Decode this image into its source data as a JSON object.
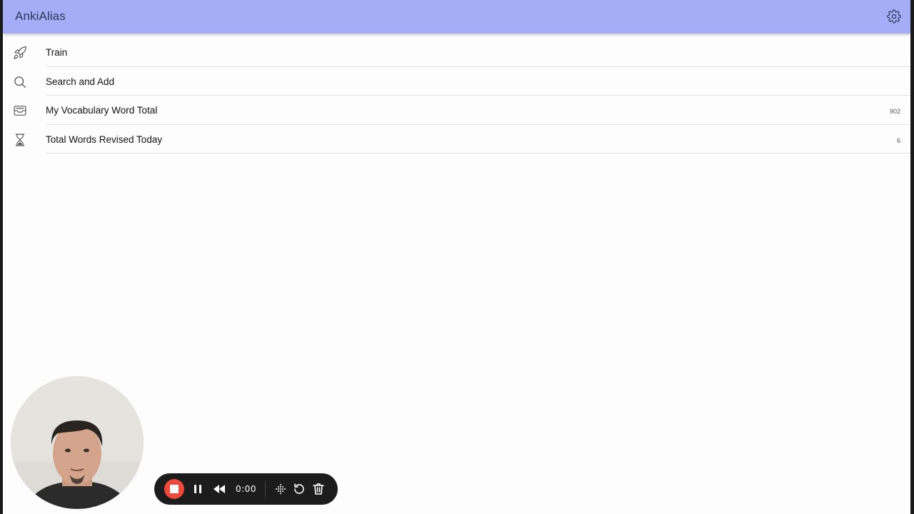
{
  "app": {
    "title": "AnkiAlias",
    "header_color": "#a4adf5"
  },
  "header": {
    "settings_icon": "gear-icon"
  },
  "menu": {
    "items": [
      {
        "icon": "rocket-icon",
        "label": "Train",
        "count": ""
      },
      {
        "icon": "search-icon",
        "label": "Search and Add",
        "count": ""
      },
      {
        "icon": "inbox-icon",
        "label": "My Vocabulary Word Total",
        "count": "902"
      },
      {
        "icon": "hourglass-icon",
        "label": "Total Words Revised Today",
        "count": "6"
      }
    ]
  },
  "recorder": {
    "time": "0:00",
    "stop_color": "#ee4a3c",
    "controls": [
      "stop-icon",
      "pause-icon",
      "rewind-icon",
      "grid-icon",
      "restart-icon",
      "trash-icon"
    ]
  },
  "webcam": {
    "icon": "webcam-bubble"
  }
}
